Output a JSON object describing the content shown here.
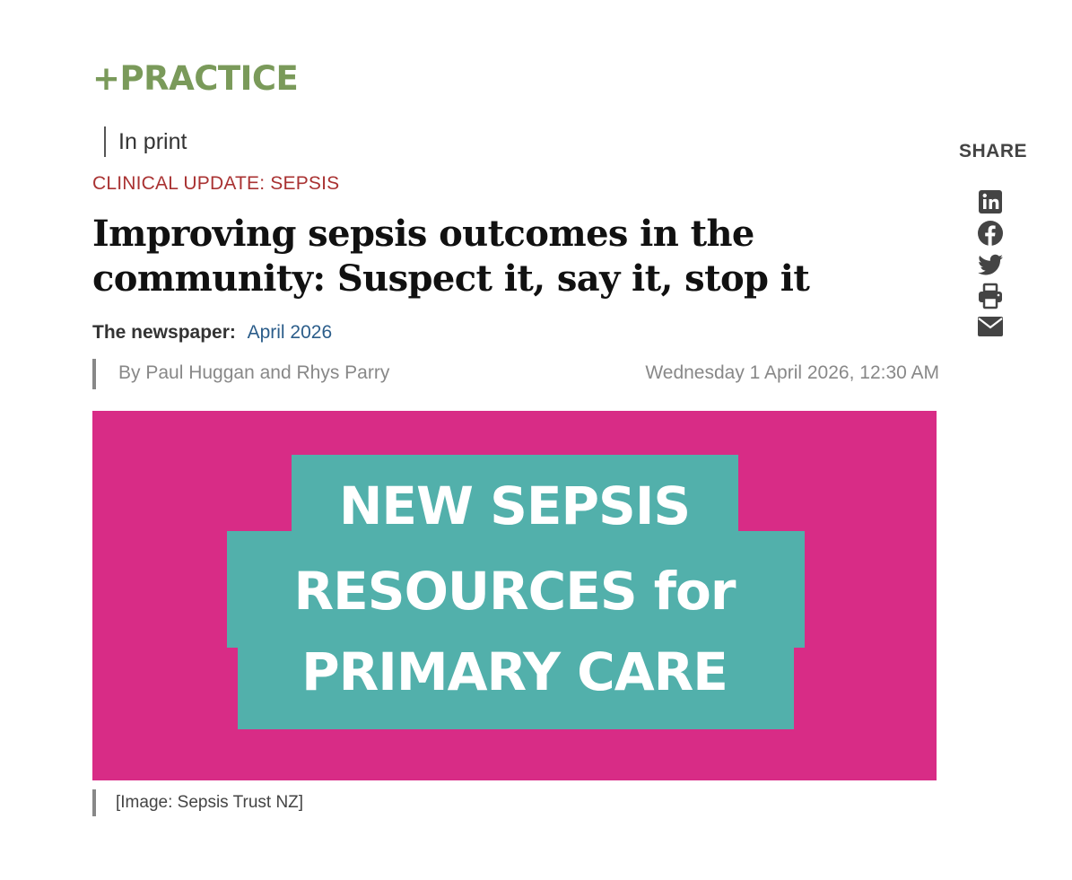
{
  "brand": {
    "name": "+PRACTICE"
  },
  "section": {
    "label": "In print"
  },
  "article": {
    "category": "CLINICAL UPDATE: SEPSIS",
    "headline": "Improving sepsis outcomes in the community: Suspect it, say it, stop it",
    "newspaper_label": "The newspaper:",
    "issue": "April 2026",
    "byline": "By Paul Huggan and Rhys Parry",
    "date": "Wednesday 1 April 2026, 12:30 AM"
  },
  "hero": {
    "line1": "NEW SEPSIS",
    "line2": "RESOURCES for",
    "line3": "PRIMARY CARE",
    "bg_color": "#d82c86",
    "panel_color": "#52b0ab"
  },
  "caption": "[Image: Sepsis Trust NZ]",
  "share": {
    "label": "SHARE",
    "icons": [
      "linkedin-icon",
      "facebook-icon",
      "twitter-icon",
      "print-icon",
      "email-icon"
    ],
    "icon_color": "#444444"
  },
  "colors": {
    "brand": "#7a9a5a",
    "category": "#a93232",
    "link": "#2b5d8a"
  }
}
